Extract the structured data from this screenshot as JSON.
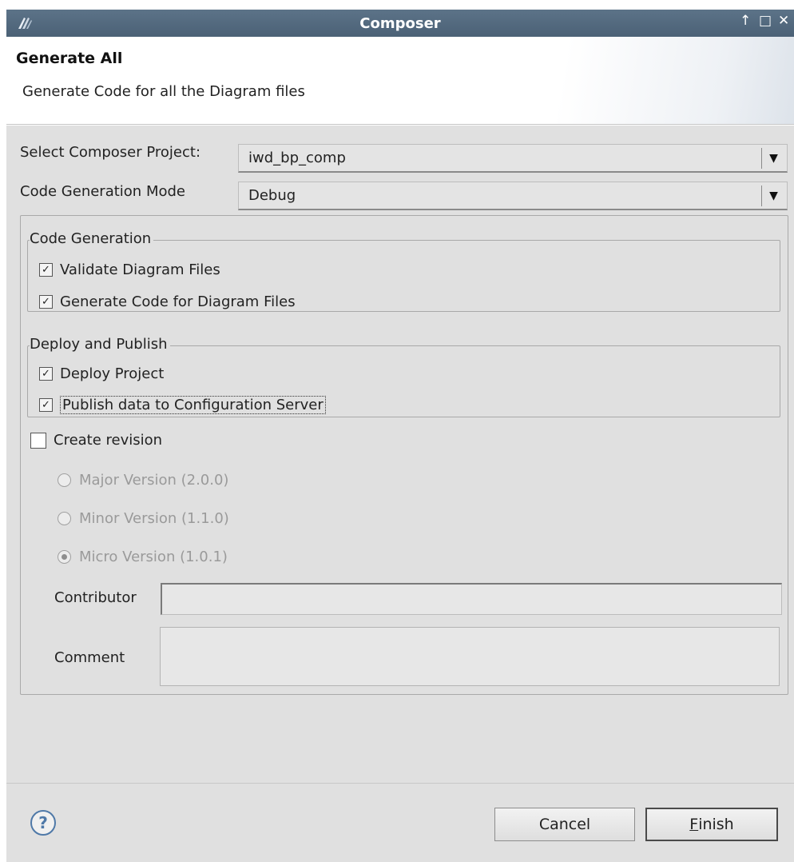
{
  "window": {
    "title": "Composer",
    "controls": [
      "↑",
      "□",
      "✕"
    ]
  },
  "header": {
    "heading": "Generate All",
    "description": "Generate Code for all the Diagram files"
  },
  "form": {
    "project_label": "Select Composer Project:",
    "project_value": "iwd_bp_comp",
    "mode_label": "Code Generation Mode",
    "mode_value": "Debug"
  },
  "code_generation": {
    "title": "Code Generation",
    "validate_label": "Validate Diagram Files",
    "validate_checked": true,
    "generate_label": "Generate Code for Diagram Files",
    "generate_checked": true
  },
  "deploy_publish": {
    "title": "Deploy and Publish",
    "deploy_label": "Deploy Project",
    "deploy_checked": true,
    "publish_label": "Publish data to Configuration Server",
    "publish_checked": true
  },
  "revision": {
    "create_label": "Create revision",
    "create_checked": false,
    "options": [
      {
        "label": "Major Version (2.0.0)",
        "selected": false
      },
      {
        "label": "Minor Version (1.1.0)",
        "selected": false
      },
      {
        "label": "Micro Version (1.0.1)",
        "selected": true
      }
    ],
    "contributor_label": "Contributor",
    "contributor_value": "",
    "comment_label": "Comment",
    "comment_value": ""
  },
  "footer": {
    "help_symbol": "?",
    "cancel_label": "Cancel",
    "finish_mnemonic": "F",
    "finish_rest": "inish"
  },
  "icons": {
    "app": "composer-logo-icon",
    "dropdown": "▼",
    "check": "✓"
  },
  "colors": {
    "titlebar": "#536a80",
    "panel": "#e0e0e0",
    "help_blue": "#4f79a8"
  }
}
